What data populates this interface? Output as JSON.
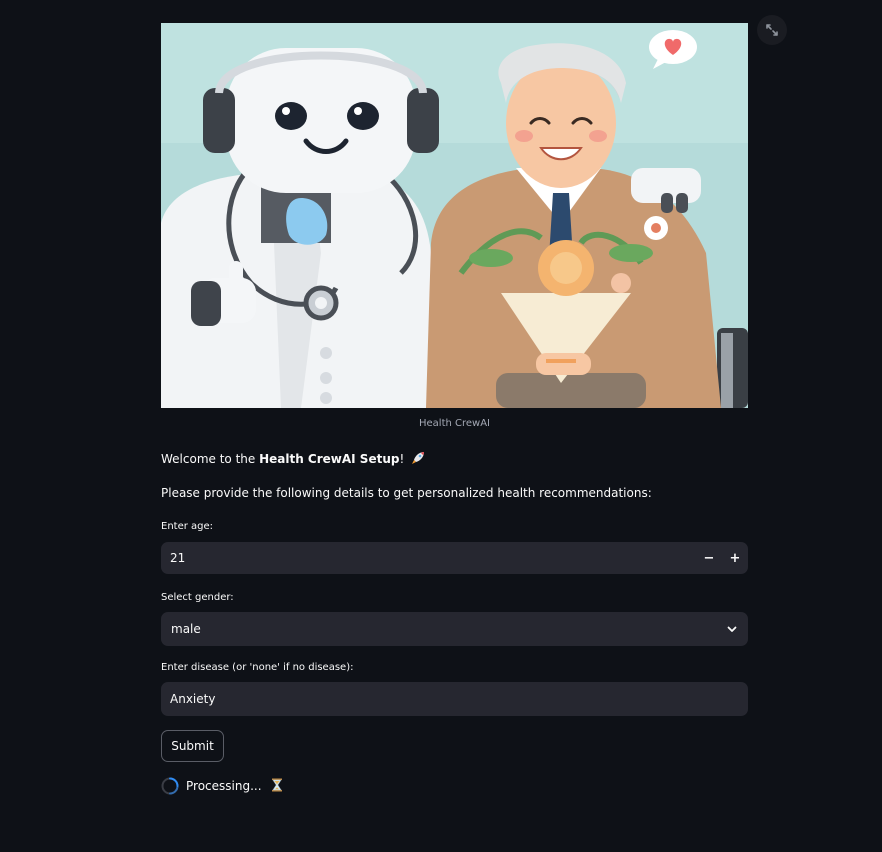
{
  "image": {
    "caption": "Health CrewAI"
  },
  "welcome": {
    "prefix": "Welcome to the ",
    "bold": "Health CrewAI Setup",
    "suffix": "!"
  },
  "instructions": "Please provide the following details to get personalized health recommendations:",
  "form": {
    "age": {
      "label": "Enter age:",
      "value": "21",
      "decrement": "−",
      "increment": "+"
    },
    "gender": {
      "label": "Select gender:",
      "value": "male"
    },
    "disease": {
      "label": "Enter disease (or 'none' if no disease):",
      "value": "Anxiety"
    },
    "submit_label": "Submit"
  },
  "status": {
    "text": "Processing..."
  },
  "colors": {
    "background": "#0e1117",
    "input_bg": "#262730",
    "spinner_accent": "#2f8cf5"
  },
  "icons": [
    "fullscreen-icon",
    "rocket-icon",
    "chevron-down-icon",
    "spinner-icon",
    "hourglass-icon"
  ]
}
